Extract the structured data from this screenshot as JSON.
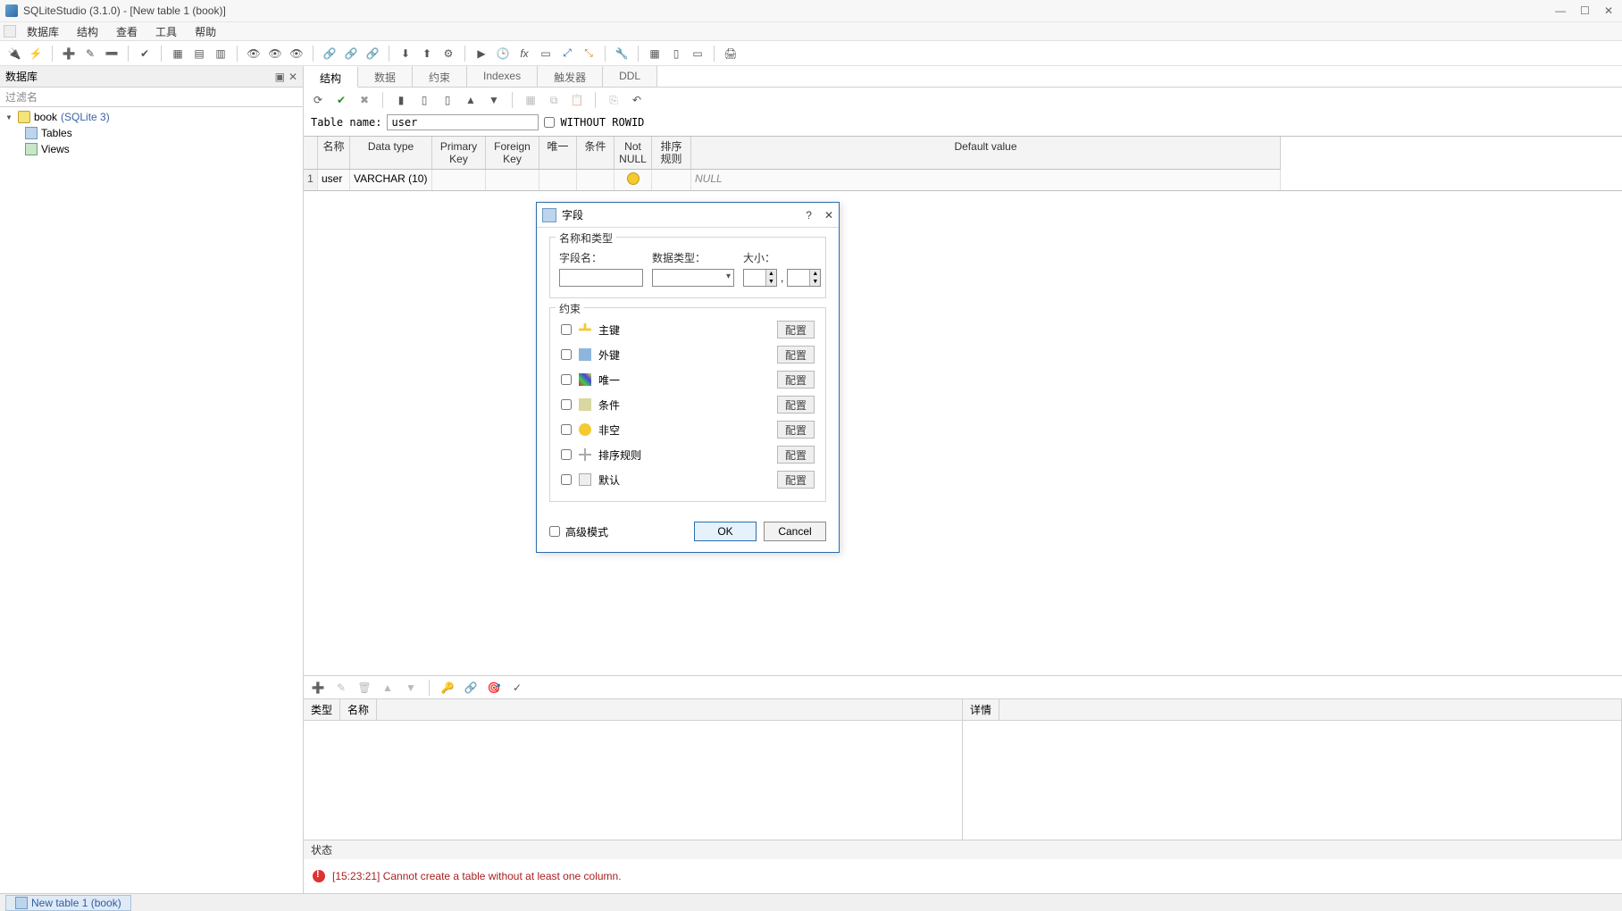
{
  "window": {
    "title": "SQLiteStudio (3.1.0) - [New table 1 (book)]"
  },
  "menu": {
    "items": [
      "数据库",
      "结构",
      "查看",
      "工具",
      "帮助"
    ]
  },
  "sidebar": {
    "title": "数据库",
    "filter_placeholder": "过滤名",
    "db_name": "book",
    "db_type": "(SQLite 3)",
    "nodes": [
      "Tables",
      "Views"
    ]
  },
  "editor_tabs": [
    "结构",
    "数据",
    "约束",
    "Indexes",
    "触发器",
    "DDL"
  ],
  "table_name_label": "Table name:",
  "table_name_value": "user",
  "without_rowid_label": "WITHOUT ROWID",
  "cols_header": {
    "name": "名称",
    "datatype": "Data type",
    "pk": "Primary Key",
    "fk": "Foreign Key",
    "unique": "唯一",
    "cond": "条件",
    "notnull": "Not NULL",
    "sort": "排序规则",
    "default": "Default value"
  },
  "col_row": {
    "num": "1",
    "name": "user",
    "type": "VARCHAR (10)",
    "default": "NULL"
  },
  "constraints_panel": {
    "type": "类型",
    "name": "名称",
    "details": "详情"
  },
  "status_label": "状态",
  "status_msg": "[15:23:21] Cannot create a table without at least one column.",
  "task_tab": "New table 1 (book)",
  "dialog": {
    "title": "字段",
    "grp_nat": "名称和类型",
    "lbl_colname": "字段名：",
    "lbl_datatype": "数据类型：",
    "lbl_size": "大小：",
    "grp_constraints": "约束",
    "constraints": [
      {
        "key": "pk",
        "label": "主键",
        "icon": "ico-key"
      },
      {
        "key": "fk",
        "label": "外键",
        "icon": "ico-fk"
      },
      {
        "key": "unique",
        "label": "唯一",
        "icon": "ico-uni"
      },
      {
        "key": "cond",
        "label": "条件",
        "icon": "ico-cond"
      },
      {
        "key": "notnull",
        "label": "非空",
        "icon": "ico-nn"
      },
      {
        "key": "sort",
        "label": "排序规则",
        "icon": "ico-sort"
      },
      {
        "key": "default",
        "label": "默认",
        "icon": "ico-def"
      }
    ],
    "cfg_label": "配置",
    "advanced": "高级模式",
    "ok": "OK",
    "cancel": "Cancel"
  }
}
